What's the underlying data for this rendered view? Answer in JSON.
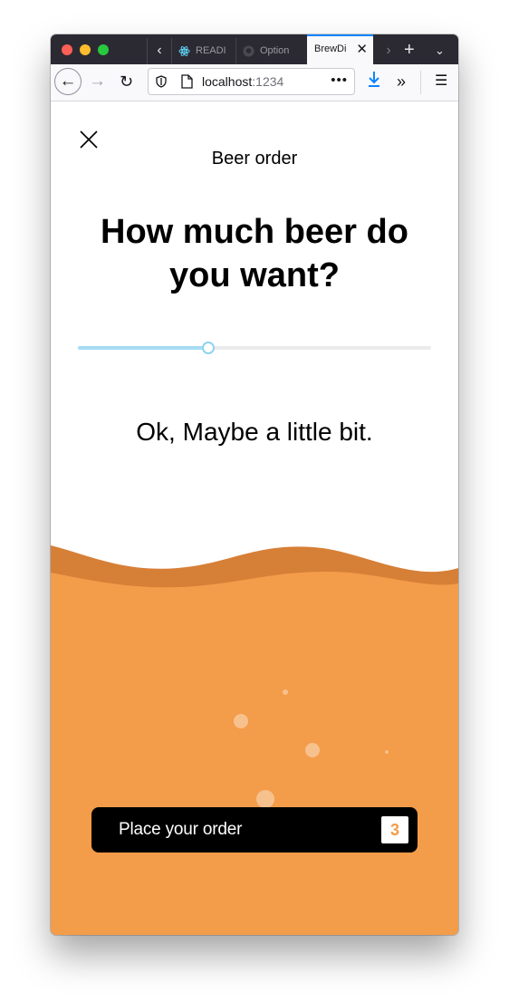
{
  "browser": {
    "tabs": [
      {
        "title": "READI",
        "icon": "react-icon"
      },
      {
        "title": "Option",
        "icon": "github-icon"
      },
      {
        "title": "BrewDi",
        "active": true
      }
    ],
    "address": {
      "host": "localhost",
      "port": ":1234"
    }
  },
  "page": {
    "title": "Beer order",
    "question": "How much beer do you want?",
    "answer": "Ok, Maybe a little bit.",
    "slider": {
      "value": 0.37
    },
    "order_button": {
      "label": "Place your order",
      "count": "3"
    }
  },
  "colors": {
    "beer": "#f39c4a",
    "foam": "#d67f36",
    "slider_fill": "#a6dcf2",
    "slider_track": "#ebebeb",
    "tab_accent": "#0a84ff"
  }
}
